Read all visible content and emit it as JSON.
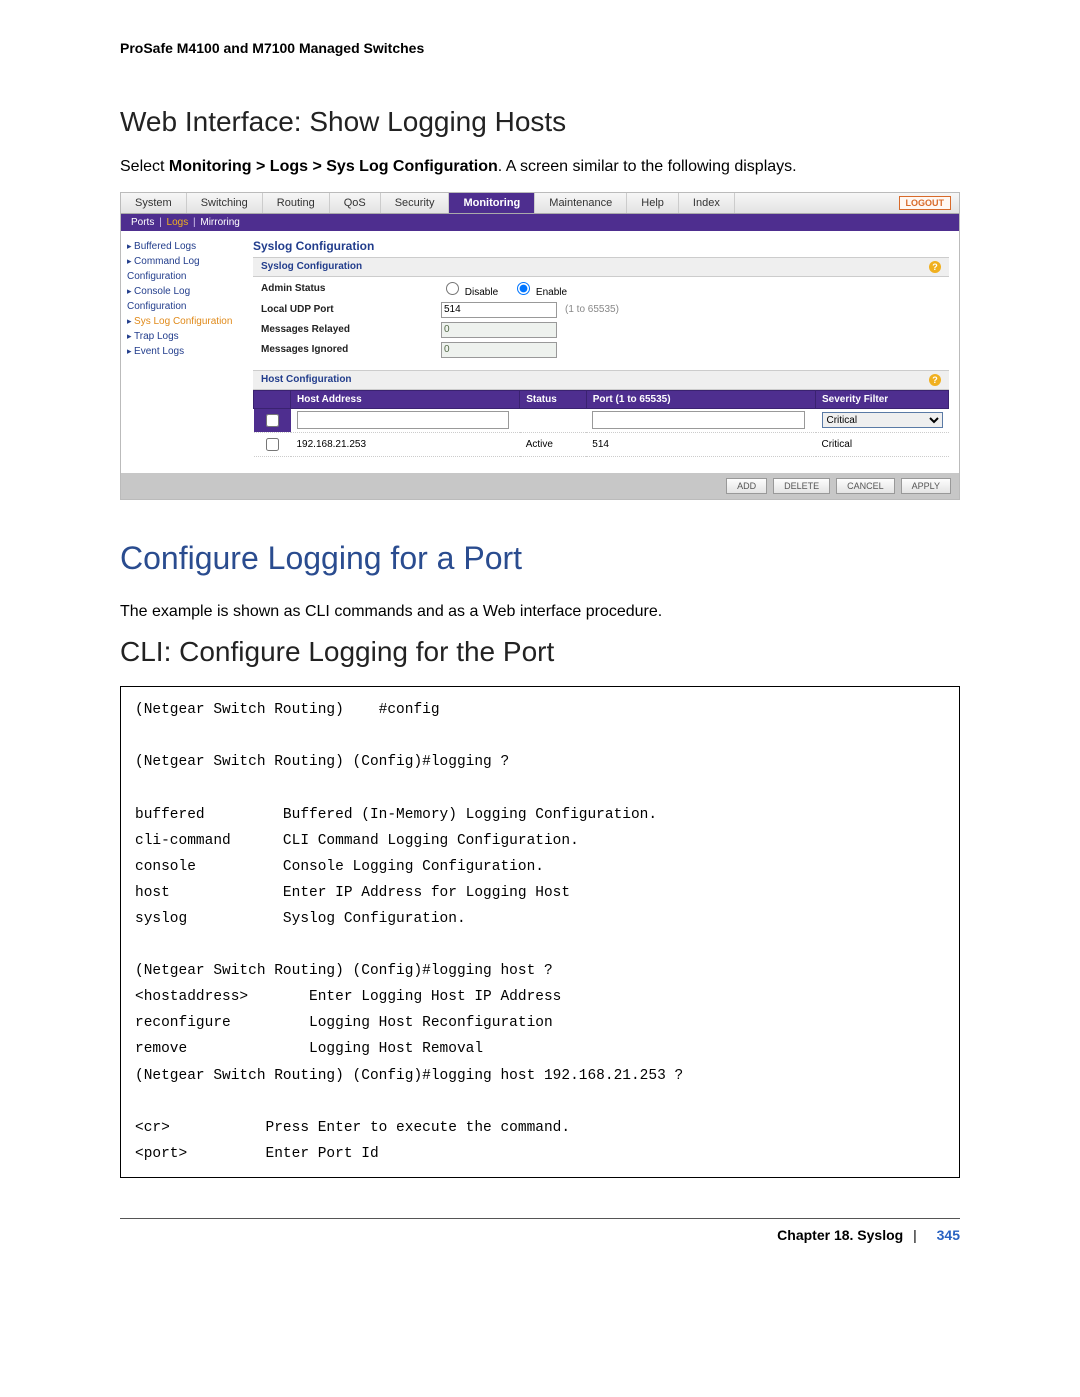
{
  "header": {
    "running": "ProSafe M4100 and M7100 Managed Switches"
  },
  "sections": {
    "web_heading": "Web Interface: Show Logging Hosts",
    "web_intro_pre": "Select ",
    "web_intro_strong": "Monitoring > Logs > Sys Log Configuration",
    "web_intro_post": ". A screen similar to the following displays.",
    "major_heading": "Configure Logging for a Port",
    "major_intro": "The example is shown as CLI commands and as a Web interface procedure.",
    "cli_heading": "CLI: Configure Logging for the Port"
  },
  "shot": {
    "tabs": [
      "System",
      "Switching",
      "Routing",
      "QoS",
      "Security",
      "Monitoring",
      "Maintenance",
      "Help",
      "Index"
    ],
    "active_tab": "Monitoring",
    "logout": "LOGOUT",
    "subnav": {
      "a": "Ports",
      "b": "Logs",
      "c": "Mirroring"
    },
    "sidebar": [
      "Buffered Logs",
      "Command Log Configuration",
      "Console Log Configuration",
      "Sys Log Configuration",
      "Trap Logs",
      "Event Logs"
    ],
    "sidebar_active": "Sys Log Configuration",
    "syslog": {
      "block_title": "Syslog Configuration",
      "section_title": "Syslog Configuration",
      "admin_status_label": "Admin Status",
      "disable": "Disable",
      "enable": "Enable",
      "local_port_label": "Local UDP Port",
      "local_port_value": "514",
      "local_port_hint": "(1 to 65535)",
      "relayed_label": "Messages Relayed",
      "relayed_value": "0",
      "ignored_label": "Messages Ignored",
      "ignored_value": "0"
    },
    "host": {
      "section_title": "Host Configuration",
      "headers": [
        "",
        "Host Address",
        "Status",
        "Port (1 to 65535)",
        "Severity Filter"
      ],
      "new_row": {
        "host": "",
        "status": "",
        "port": "",
        "severity": "Critical"
      },
      "row": {
        "host": "192.168.21.253",
        "status": "Active",
        "port": "514",
        "severity": "Critical"
      }
    },
    "footer": [
      "ADD",
      "DELETE",
      "CANCEL",
      "APPLY"
    ]
  },
  "cli": "(Netgear Switch Routing)    #config\n\n(Netgear Switch Routing) (Config)#logging ?\n\nbuffered         Buffered (In-Memory) Logging Configuration.\ncli-command      CLI Command Logging Configuration.\nconsole          Console Logging Configuration.\nhost             Enter IP Address for Logging Host\nsyslog           Syslog Configuration.\n\n(Netgear Switch Routing) (Config)#logging host ?\n<hostaddress>       Enter Logging Host IP Address\nreconfigure         Logging Host Reconfiguration\nremove              Logging Host Removal\n(Netgear Switch Routing) (Config)#logging host 192.168.21.253 ?\n\n<cr>           Press Enter to execute the command.\n<port>         Enter Port Id",
  "footer": {
    "chapter": "Chapter 18.  Syslog",
    "page": "345"
  }
}
